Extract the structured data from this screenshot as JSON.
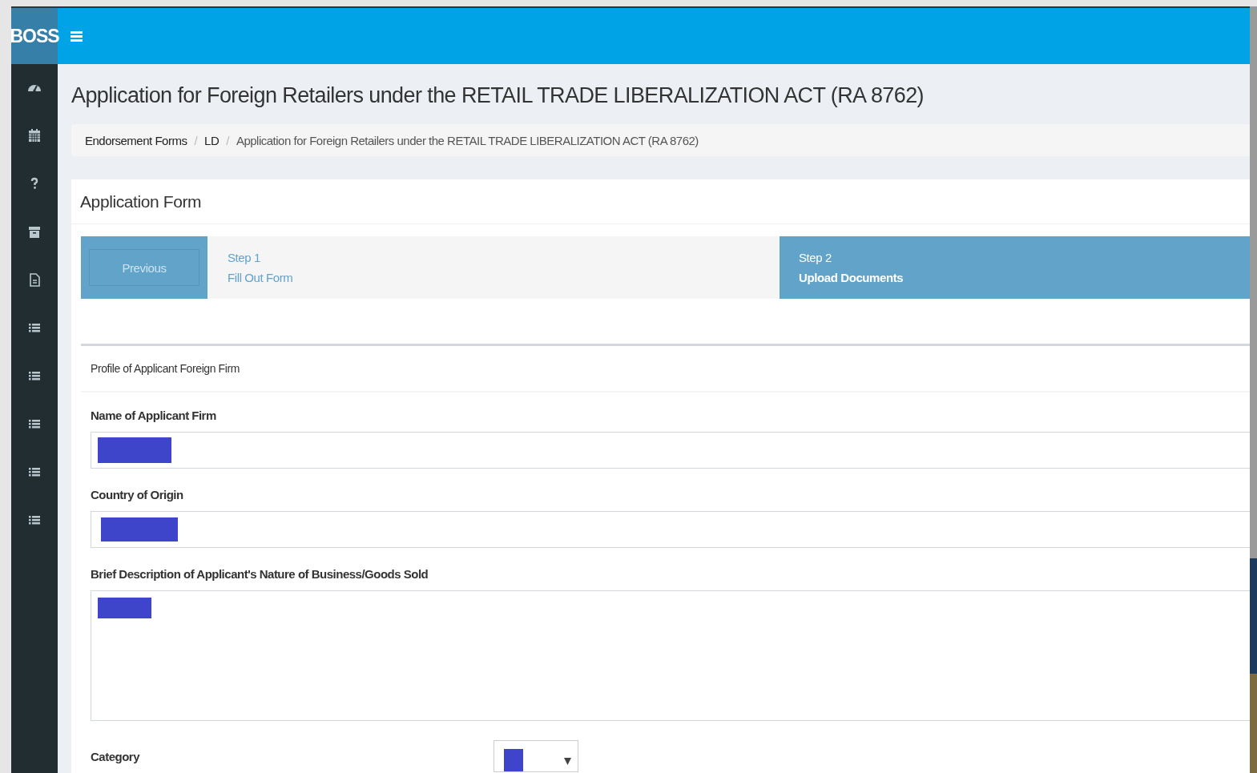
{
  "header": {
    "brand": "BOSS"
  },
  "sidebar": {
    "items": [
      {
        "kind": "dashboard"
      },
      {
        "kind": "calendar"
      },
      {
        "kind": "help"
      },
      {
        "kind": "archive"
      },
      {
        "kind": "document"
      },
      {
        "kind": "list"
      },
      {
        "kind": "list"
      },
      {
        "kind": "list"
      },
      {
        "kind": "list"
      },
      {
        "kind": "list"
      }
    ]
  },
  "page_title": "Application for Foreign Retailers under the RETAIL TRADE LIBERALIZATION ACT (RA 8762)",
  "breadcrumb": {
    "separator": "/",
    "items": [
      "Endorsement Forms",
      "LD",
      "Application for Foreign Retailers under the RETAIL TRADE LIBERALIZATION ACT (RA 8762)"
    ]
  },
  "card": {
    "title": "Application Form",
    "wizard": {
      "previous_button": "Previous",
      "steps": [
        {
          "number": "Step 1",
          "label": "Fill Out Form",
          "selected": false
        },
        {
          "number": "Step 2",
          "label": "Upload Documents",
          "selected": true
        }
      ]
    },
    "section": {
      "title": "Profile of Applicant Foreign Firm",
      "fields": [
        {
          "kind": "text",
          "label": "Name of Applicant Firm",
          "redacted": true
        },
        {
          "kind": "text",
          "label": "Country of Origin",
          "redacted": true
        },
        {
          "kind": "textarea",
          "label": "Brief Description of Applicant's Nature of Business/Goods Sold",
          "redacted": true
        },
        {
          "kind": "select",
          "label": "Category",
          "redacted": true
        }
      ]
    }
  }
}
